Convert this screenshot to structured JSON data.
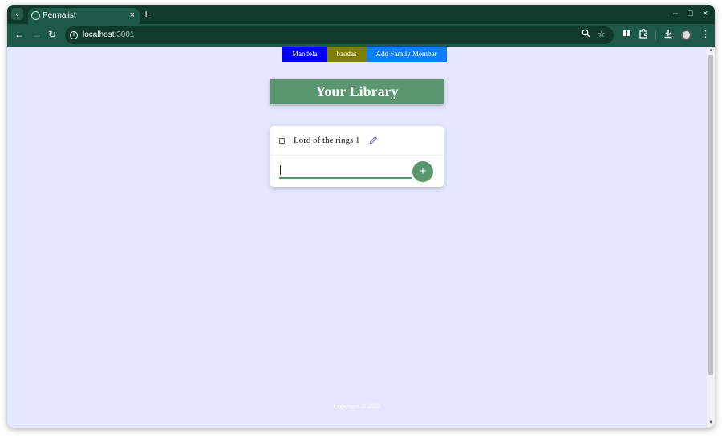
{
  "browser": {
    "tab": {
      "title": "Permalist",
      "close_glyph": "×"
    },
    "tab_menu_glyph": "⌄",
    "new_tab_glyph": "+",
    "window_controls": {
      "minimize": "–",
      "maximize": "□",
      "close": "×"
    },
    "nav": {
      "back": "←",
      "forward": "→",
      "reload": "↻"
    },
    "address": {
      "host": "localhost",
      "port": ":3001"
    },
    "omnibox_icons": {
      "zoom": "zoom-icon",
      "bookmark": "star-icon"
    },
    "toolbar_icons": [
      "reading-list-icon",
      "extensions-icon",
      "download-icon",
      "profile-avatar",
      "menu-icon"
    ]
  },
  "page": {
    "member_tabs": [
      {
        "label": "Mandela",
        "color": "#0000ff"
      },
      {
        "label": "baodas",
        "color": "#808000"
      },
      {
        "label": "Add Family Member",
        "color": "#0d7ffb"
      }
    ],
    "heading": "Your Library",
    "items": [
      {
        "title": "Lord of the rings 1",
        "checked": false
      }
    ],
    "new_item": {
      "value": "",
      "placeholder": ""
    },
    "add_button_label": "+",
    "footer": "Copyright © 2024"
  },
  "colors": {
    "accent": "#5a9670",
    "page_background": "#e3e6fc",
    "browser_frame": "#0f3a2c",
    "browser_toolbar": "#1d5947",
    "edit_icon": "#8b73d6"
  }
}
